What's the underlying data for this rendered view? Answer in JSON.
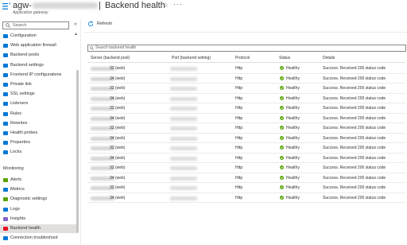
{
  "header": {
    "resource_prefix": "agw-",
    "separator": "|",
    "title": "Backend health",
    "subtitle": "Application gateway",
    "more": "···"
  },
  "sidebar": {
    "search_placeholder": "Search",
    "collapse": "«",
    "items_top": [
      {
        "label": "Configuration",
        "icon": "configuration-icon",
        "color": "#0078d4"
      },
      {
        "label": "Web application firewall",
        "icon": "firewall-icon",
        "color": "#0078d4"
      },
      {
        "label": "Backend pools",
        "icon": "backend-pools-icon",
        "color": "#0078d4"
      },
      {
        "label": "Backend settings",
        "icon": "backend-settings-icon",
        "color": "#0078d4"
      },
      {
        "label": "Frontend IP configurations",
        "icon": "frontend-ip-icon",
        "color": "#0078d4"
      },
      {
        "label": "Private link",
        "icon": "private-link-icon",
        "color": "#0078d4"
      },
      {
        "label": "SSL settings",
        "icon": "ssl-icon",
        "color": "#0078d4"
      },
      {
        "label": "Listeners",
        "icon": "listeners-icon",
        "color": "#0078d4"
      },
      {
        "label": "Rules",
        "icon": "rules-icon",
        "color": "#0078d4"
      },
      {
        "label": "Rewrites",
        "icon": "rewrites-icon",
        "color": "#0078d4"
      },
      {
        "label": "Health probes",
        "icon": "health-probes-icon",
        "color": "#0078d4"
      },
      {
        "label": "Properties",
        "icon": "properties-icon",
        "color": "#0078d4"
      },
      {
        "label": "Locks",
        "icon": "lock-icon",
        "color": "#0078d4"
      }
    ],
    "section_monitoring": "Monitoring",
    "items_monitoring": [
      {
        "label": "Alerts",
        "icon": "alerts-icon",
        "color": "#57a300"
      },
      {
        "label": "Metrics",
        "icon": "metrics-icon",
        "color": "#0078d4"
      },
      {
        "label": "Diagnostic settings",
        "icon": "diagnostic-icon",
        "color": "#57a300"
      },
      {
        "label": "Logs",
        "icon": "logs-icon",
        "color": "#0078d4"
      },
      {
        "label": "Insights",
        "icon": "insights-icon",
        "color": "#8661c5"
      },
      {
        "label": "Backend health",
        "icon": "heart-icon",
        "color": "#e81123",
        "selected": true
      },
      {
        "label": "Connection troubleshoot",
        "icon": "connection-icon",
        "color": "#0078d4"
      }
    ]
  },
  "toolbar": {
    "refresh_label": "Refresh"
  },
  "table": {
    "search_placeholder": "Search backend health",
    "columns": [
      "Server (backend pool)",
      "Port (backend setting)",
      "Protocol",
      "Status",
      "Details"
    ],
    "rows": [
      {
        "server_suffix": "32 (web)",
        "protocol": "Http",
        "status": "Healthy",
        "details": "Success. Received 200 status code"
      },
      {
        "server_suffix": "34 (web)",
        "protocol": "Http",
        "status": "Healthy",
        "details": "Success. Received 200 status code"
      },
      {
        "server_suffix": "32 (web)",
        "protocol": "Http",
        "status": "Healthy",
        "details": "Success. Received 200 status code"
      },
      {
        "server_suffix": "34 (web)",
        "protocol": "Http",
        "status": "Healthy",
        "details": "Success. Received 200 status code"
      },
      {
        "server_suffix": "32 (web)",
        "protocol": "Http",
        "status": "Healthy",
        "details": "Success. Received 200 status code"
      },
      {
        "server_suffix": "34 (web)",
        "protocol": "Http",
        "status": "Healthy",
        "details": "Success. Received 200 status code"
      },
      {
        "server_suffix": "32 (web)",
        "protocol": "Http",
        "status": "Healthy",
        "details": "Success. Received 200 status code"
      },
      {
        "server_suffix": "34 (web)",
        "protocol": "Http",
        "status": "Healthy",
        "details": "Success. Received 200 status code"
      },
      {
        "server_suffix": "32 (web)",
        "protocol": "Http",
        "status": "Healthy",
        "details": "Success. Received 200 status code"
      },
      {
        "server_suffix": "34 (web)",
        "protocol": "Http",
        "status": "Healthy",
        "details": "Success. Received 200 status code"
      },
      {
        "server_suffix": "32 (web)",
        "protocol": "Http",
        "status": "Healthy",
        "details": "Success. Received 200 status code"
      },
      {
        "server_suffix": "34 (web)",
        "protocol": "Http",
        "status": "Healthy",
        "details": "Success. Received 200 status code"
      },
      {
        "server_suffix": "32 (web)",
        "protocol": "Http",
        "status": "Healthy",
        "details": "Success. Received 200 status code"
      },
      {
        "server_suffix": "34 (web)",
        "protocol": "Http",
        "status": "Healthy",
        "details": "Success. Received 200 status code"
      }
    ]
  },
  "colors": {
    "accent": "#0078d4",
    "healthy": "#57a300",
    "selected_bg": "#e1dfdd"
  }
}
